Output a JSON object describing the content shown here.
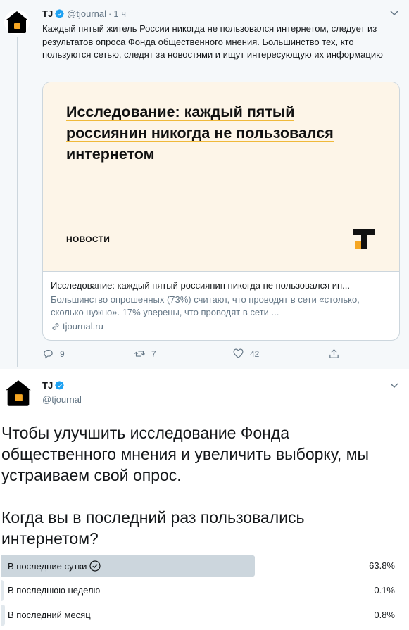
{
  "parent_tweet": {
    "name": "TJ",
    "handle": "@tjournal",
    "separator": "·",
    "time": "1 ч",
    "text": "Каждый пятый житель России никогда не пользовался интернетом, следует из результатов опроса Фонда общественного мнения. Большинство тех, кто пользуются сетью, следят за новостями и ищут интересующую их информацию",
    "card": {
      "image_headline": "Исследование: каждый пятый россиянин никогда не пользовался интернетом",
      "image_section": "НОВОСТИ",
      "title": "Исследование: каждый пятый россиянин никогда не пользовался ин...",
      "description": "Большинство опрошенных (73%) считают, что проводят в сети «столько, сколько нужно». 17% уверены, что проводят в сети ...",
      "domain": "tjournal.ru"
    },
    "actions": {
      "replies": "9",
      "retweets": "7",
      "likes": "42"
    }
  },
  "main_tweet": {
    "name": "TJ",
    "handle": "@tjournal",
    "text_paragraph_1": "Чтобы улучшить исследование Фонда общественного мнения и увеличить выборку, мы устраиваем свой опрос.",
    "text_paragraph_2": "Когда вы в последний раз пользовались интернетом?",
    "poll": [
      {
        "label": "В последние сутки",
        "percent": "63.8%",
        "value": 63.8,
        "selected": true
      },
      {
        "label": "В последнюю неделю",
        "percent": "0.1%",
        "value": 0.1,
        "selected": false
      },
      {
        "label": "В последний месяц",
        "percent": "0.8%",
        "value": 0.8,
        "selected": false
      }
    ]
  },
  "colors": {
    "verified": "#1da1f2",
    "accent_logo": "#f5a623",
    "poll_bar": "#ccd6dd",
    "muted_text": "#657786"
  },
  "icons": [
    "verified-badge-icon",
    "chevron-down-icon",
    "reply-icon",
    "retweet-icon",
    "like-icon",
    "share-icon",
    "link-icon",
    "check-circle-icon"
  ]
}
